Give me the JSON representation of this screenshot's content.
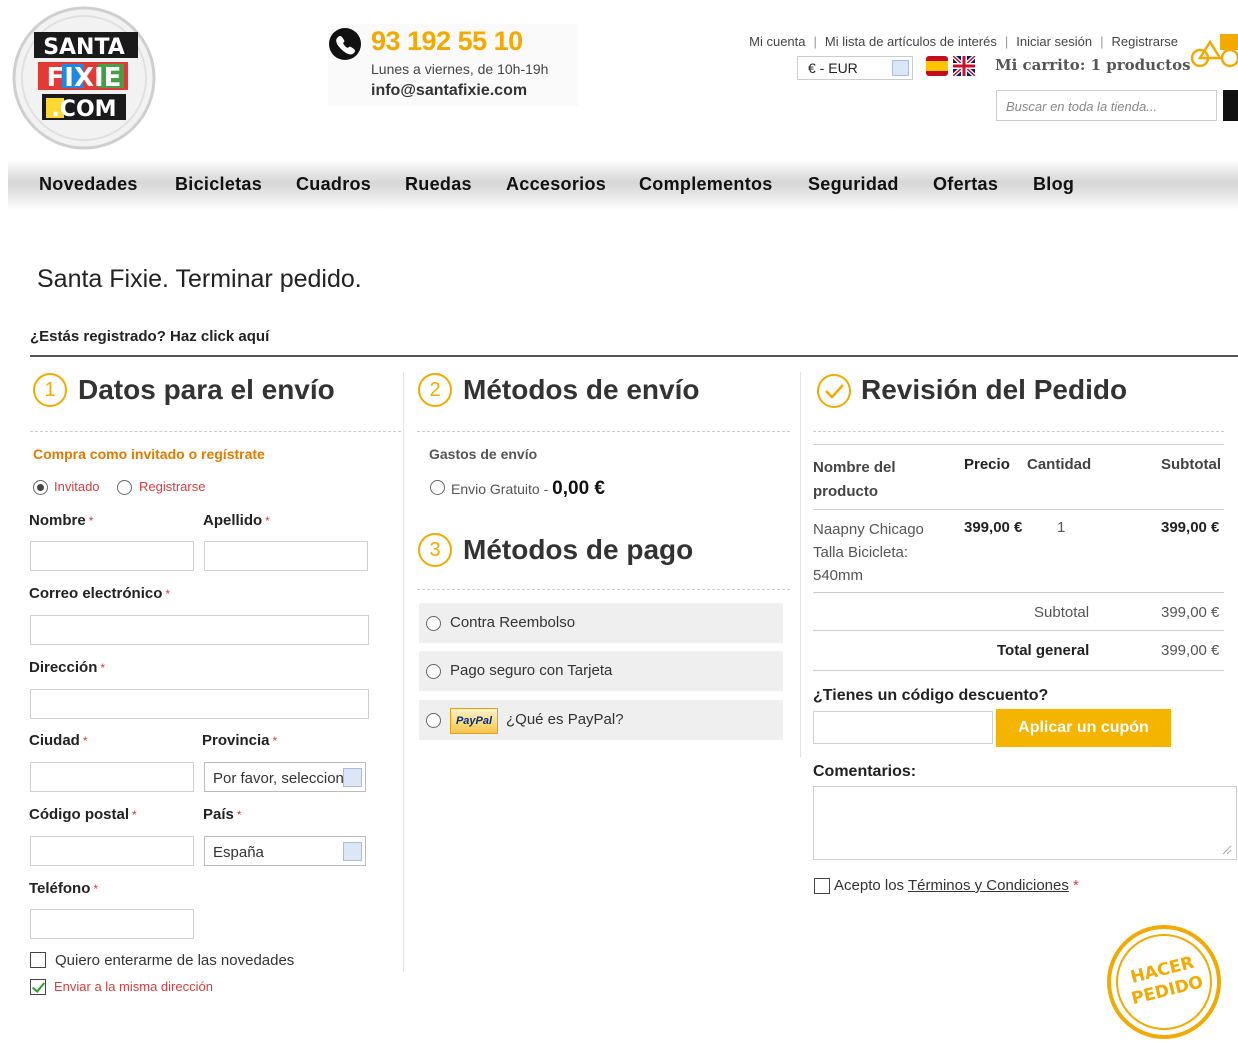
{
  "header": {
    "logo_text": [
      "SANTA",
      "FIXIE",
      ".COM"
    ],
    "phone": "93 192 55 10",
    "hours": "Lunes a viernes, de 10h-19h",
    "email": "info@santafixie.com",
    "toplinks": [
      "Mi cuenta",
      "Mi lista de artículos de interés",
      "Iniciar sesión",
      "Registrarse"
    ],
    "currency": "€ - EUR",
    "cart": "Mi carrito: 1 productos",
    "search_placeholder": "Buscar en toda la tienda..."
  },
  "nav": [
    "Novedades",
    "Bicicletas",
    "Cuadros",
    "Ruedas",
    "Accesorios",
    "Complementos",
    "Seguridad",
    "Ofertas",
    "Blog"
  ],
  "page": {
    "title": "Santa Fixie. Terminar pedido.",
    "register_link": "¿Estás registrado? Haz click aquí"
  },
  "shipping": {
    "num": "1",
    "heading": "Datos para el envío",
    "guest_prompt": "Compra como invitado o regístrate",
    "opt_guest": "Invitado",
    "opt_register": "Registrarse",
    "first_name": "Nombre",
    "last_name": "Apellido",
    "email": "Correo electrónico",
    "address": "Dirección",
    "city": "Ciudad",
    "province": "Provincia",
    "province_value": "Por favor, seleccione",
    "postcode": "Código postal",
    "country": "País",
    "country_value": "España",
    "phone": "Teléfono",
    "newsletter": "Quiero enterarme de las novedades",
    "same_address": "Enviar a la misma dirección",
    "req": "*"
  },
  "shipping_methods": {
    "num": "2",
    "heading": "Métodos de envío",
    "costs_label": "Gastos de envío",
    "free_label": "Envio Gratuito -",
    "free_price": "0,00 €"
  },
  "payment": {
    "num": "3",
    "heading": "Métodos de pago",
    "options": [
      "Contra Reembolso",
      "Pago seguro con Tarjeta",
      "¿Qué es PayPal?"
    ],
    "paypal_logo": "PayPal"
  },
  "review": {
    "heading": "Revisión del Pedido",
    "col_name": "Nombre del producto",
    "col_price": "Precio",
    "col_qty": "Cantidad",
    "col_subtotal": "Subtotal",
    "item_name": "Naapny Chicago Talla Bicicleta: 540mm",
    "item_price": "399,00 €",
    "item_qty": "1",
    "item_subtotal": "399,00 €",
    "subtotal_label": "Subtotal",
    "subtotal_value": "399,00 €",
    "total_label": "Total general",
    "total_value": "399,00 €",
    "coupon_prompt": "¿Tienes un código descuento?",
    "coupon_button": "Aplicar un cupón",
    "comments": "Comentarios:",
    "terms_pre": "Acepto los",
    "terms_link": "Términos y Condiciones",
    "place_order": "HACER PEDIDO"
  },
  "colors": {
    "accent": "#f2a900",
    "button": "#f5b400",
    "required": "#d83c3c",
    "guest_prompt": "#e07a00"
  }
}
